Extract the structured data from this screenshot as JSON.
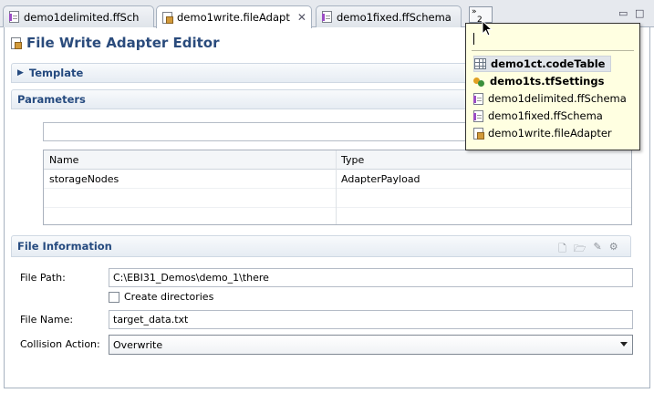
{
  "tabs": [
    {
      "label": "demo1delimited.ffSch",
      "icon": "schema-file-icon"
    },
    {
      "label": "demo1write.fileAdapt",
      "icon": "adapter-file-icon",
      "active": true
    },
    {
      "label": "demo1fixed.ffSchema",
      "icon": "schema-file-icon"
    }
  ],
  "overflow": {
    "count": "2"
  },
  "editor": {
    "title": "File Write Adapter Editor"
  },
  "sections": {
    "template": "Template",
    "parameters": "Parameters",
    "file_info": "File Information"
  },
  "parameters_table": {
    "columns": [
      "Name",
      "Type"
    ],
    "rows": [
      [
        "storageNodes",
        "AdapterPayload"
      ]
    ]
  },
  "file_info": {
    "file_path_label": "File Path:",
    "file_path_value": "C:\\EBI31_Demos\\demo_1\\there",
    "create_dirs_label": "Create directories",
    "file_name_label": "File Name:",
    "file_name_value": "target_data.txt",
    "collision_label": "Collision Action:",
    "collision_value": "Overwrite"
  },
  "popup": {
    "items": [
      {
        "label": "demo1ct.codeTable",
        "bold": true,
        "icon": "code-table-icon"
      },
      {
        "label": "demo1ts.tfSettings",
        "bold": true,
        "icon": "settings-icon"
      },
      {
        "label": "demo1delimited.ffSchema",
        "bold": false,
        "icon": "schema-file-icon"
      },
      {
        "label": "demo1fixed.ffSchema",
        "bold": false,
        "icon": "schema-file-icon"
      },
      {
        "label": "demo1write.fileAdapter",
        "bold": false,
        "icon": "adapter-file-icon"
      }
    ]
  }
}
